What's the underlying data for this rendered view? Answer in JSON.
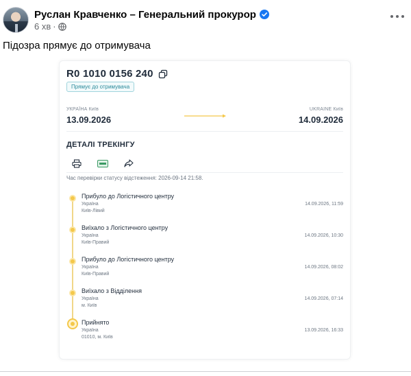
{
  "post": {
    "author": "Руслан Кравченко – Генеральний прокурор",
    "time": "6 хв",
    "separator": "·",
    "text": "Підозра прямує до отримувача",
    "icons": {
      "verified": "verified-badge-icon",
      "audience": "globe-icon",
      "menu": "more-options-icon"
    }
  },
  "tracking": {
    "number": "R0 1010 0156 240",
    "status": "Прямує до отримувача",
    "from": {
      "label": "УКРАЇНА Київ",
      "date": "13.09.2026"
    },
    "to": {
      "label": "UKRAINE Київ",
      "date": "14.09.2026"
    },
    "details_title": "ДЕТАЛІ ТРЕКІНГУ",
    "actions": [
      "print-icon",
      "card-icon",
      "share-icon"
    ],
    "check_time": "Час перевірки статусу відстеження: 2026-09-14 21:58.",
    "events": [
      {
        "title": "Прибуло до Логістичного центру",
        "country": "Україна",
        "place": "Київ-Лівий",
        "time": "14.09.2026, 11:59"
      },
      {
        "title": "Виїхало з Логістичного центру",
        "country": "Україна",
        "place": "Київ-Правий",
        "time": "14.09.2026, 10:30"
      },
      {
        "title": "Прибуло до Логістичного центру",
        "country": "Україна",
        "place": "Київ-Правий",
        "time": "14.09.2026, 08:02"
      },
      {
        "title": "Виїхало з Відділення",
        "country": "Україна",
        "place": "м. Київ",
        "time": "14.09.2026, 07:14"
      },
      {
        "title": "Прийнято",
        "country": "Україна",
        "place": "01010, м. Київ",
        "time": "13.09.2026, 16:33"
      }
    ]
  },
  "colors": {
    "accent": "#f4c84a",
    "verified": "#1877f2",
    "badge": "#2a8a9a",
    "text_secondary": "#65676b"
  }
}
